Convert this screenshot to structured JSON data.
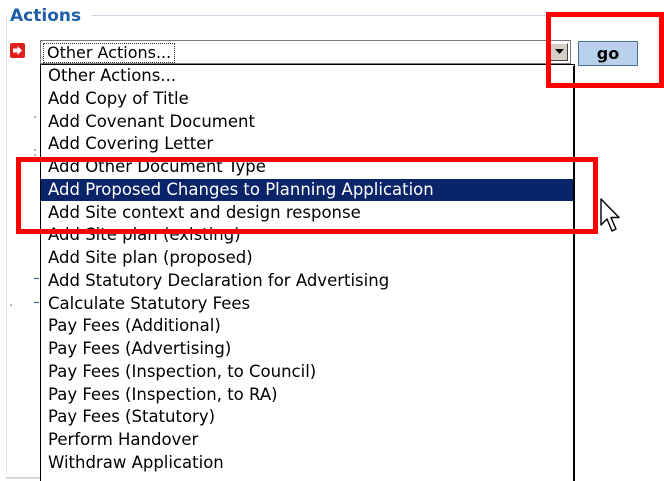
{
  "panel": {
    "title": "Actions"
  },
  "action_select": {
    "selected_value": "Other Actions...",
    "options": [
      "Other Actions...",
      "Add Copy of Title",
      "Add Covenant Document",
      "Add Covering Letter",
      "Add Other Document Type",
      "Add Proposed Changes to Planning Application",
      "Add Site context and design response",
      "Add Site plan (existing)",
      "Add Site plan (proposed)",
      "Add Statutory Declaration for Advertising",
      "Calculate Statutory Fees",
      "Pay Fees (Additional)",
      "Pay Fees (Advertising)",
      "Pay Fees (Inspection, to Council)",
      "Pay Fees (Inspection, to RA)",
      "Pay Fees (Statutory)",
      "Perform Handover",
      "Withdraw Application"
    ],
    "highlighted_option": "Add Proposed Changes to Planning Application"
  },
  "go_button": {
    "label": "go"
  },
  "icons": {
    "action_icon": "red-arrow-right-icon",
    "dropdown_icon": "dropdown-arrow-icon",
    "cursor": "mouse-pointer-icon"
  },
  "colors": {
    "title": "#1f5fa8",
    "go_button_bg": "#b9d1ea",
    "highlight_bg": "#0a246a",
    "annotation": "#ff0000"
  }
}
